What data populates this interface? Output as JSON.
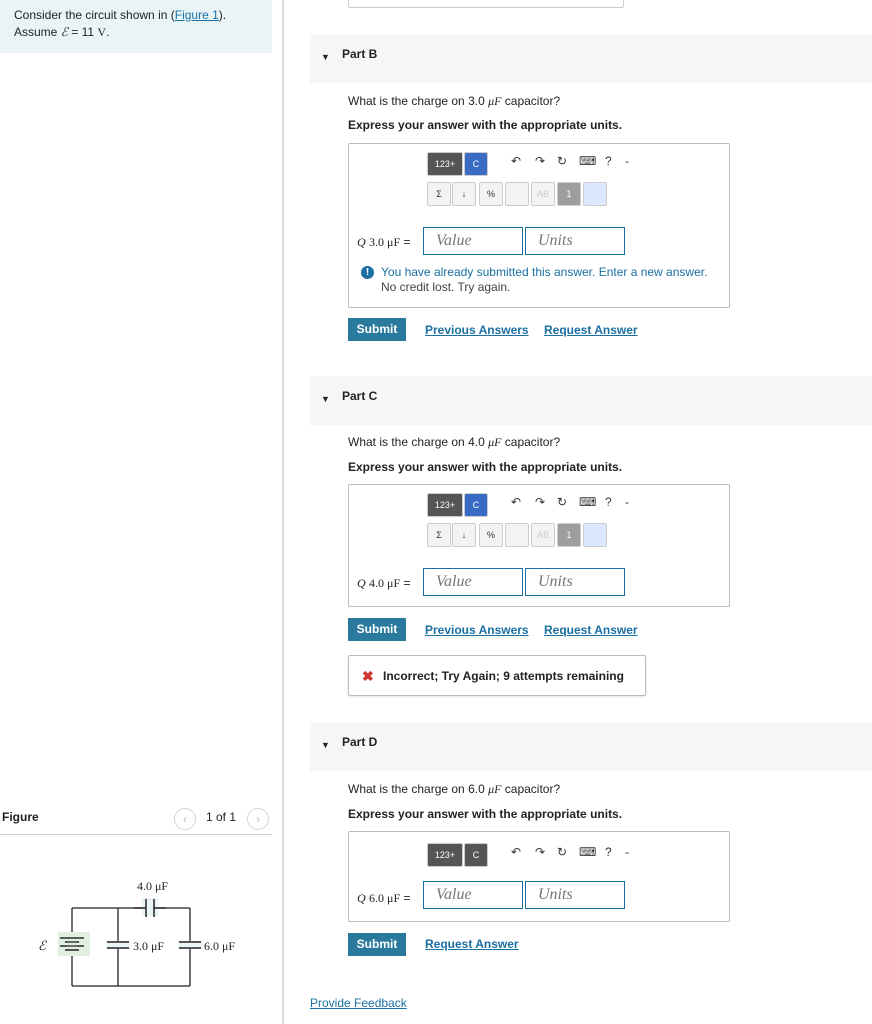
{
  "intro": {
    "line1_prefix": "Consider the circuit shown in (",
    "figure_link": "Figure 1",
    "line1_suffix": ").",
    "assume_prefix": "Assume ",
    "emf_symbol": "ℰ",
    "assume_value": " = 11 ",
    "assume_unit": "V",
    "assume_end": "."
  },
  "figure": {
    "title": "Figure",
    "prev": "‹",
    "next": "›",
    "count": "1 of 1"
  },
  "circuit_labels": {
    "emf": "ℰ",
    "c1": "4.0 μF",
    "c2": "3.0 μF",
    "c3": "6.0 μF"
  },
  "toolbar": {
    "templates": "123+",
    "c": "C",
    "sigma": "Σ",
    "down": "↓",
    "percent": "%",
    "ab": "AB",
    "one": "1",
    "undo": "↶",
    "redo": "↷",
    "reset": "↻",
    "keyboard": "⌨",
    "help": "?",
    "dash": "-"
  },
  "parts": {
    "b": {
      "title": "Part B",
      "question_prefix": "What is the charge on 3.0 ",
      "question_unit": "μF",
      "question_suffix": " capacitor?",
      "instruction": "Express your answer with the appropriate units.",
      "var": "Q",
      "var_sub": "3.0 μF",
      "equals": "=",
      "value_placeholder": "Value",
      "units_placeholder": "Units",
      "notice_line1": "You have already submitted this answer. Enter a new answer.",
      "notice_line2": "No credit lost. Try again.",
      "submit": "Submit",
      "previous": "Previous Answers",
      "request": "Request Answer"
    },
    "c": {
      "title": "Part C",
      "question_prefix": "What is the charge on 4.0 ",
      "question_unit": "μF",
      "question_suffix": " capacitor?",
      "instruction": "Express your answer with the appropriate units.",
      "var": "Q",
      "var_sub": "4.0 μF",
      "equals": "=",
      "value_placeholder": "Value",
      "units_placeholder": "Units",
      "submit": "Submit",
      "previous": "Previous Answers",
      "request": "Request Answer",
      "incorrect": "Incorrect; Try Again; 9 attempts remaining"
    },
    "d": {
      "title": "Part D",
      "question_prefix": "What is the charge on 6.0 ",
      "question_unit": "μF",
      "question_suffix": " capacitor?",
      "instruction": "Express your answer with the appropriate units.",
      "var": "Q",
      "var_sub": "6.0 μF",
      "equals": "=",
      "value_placeholder": "Value",
      "units_placeholder": "Units",
      "submit": "Submit",
      "request": "Request Answer"
    }
  },
  "feedback": "Provide Feedback"
}
